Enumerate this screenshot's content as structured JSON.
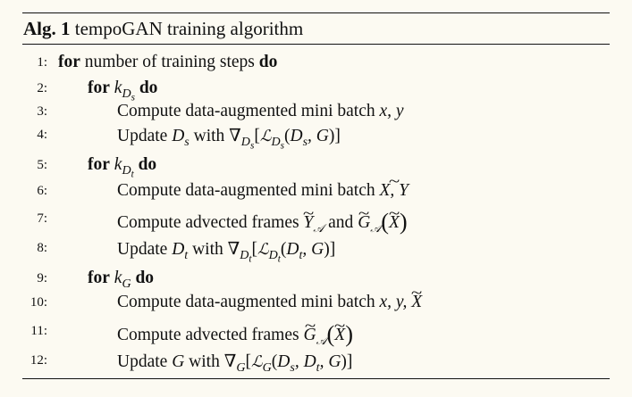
{
  "algorithm": {
    "number_label": "Alg. 1",
    "title": "tempoGAN training algorithm"
  },
  "lines": [
    {
      "num": "1:",
      "kw_for": "for",
      "text": "number of training steps",
      "kw_do": "do"
    },
    {
      "num": "2:",
      "kw_for": "for",
      "var": "k",
      "sub": "D",
      "subsub": "s",
      "kw_do": "do"
    },
    {
      "num": "3:",
      "text": "Compute data-augmented mini batch",
      "vars": "x, y"
    },
    {
      "num": "4:",
      "text_update": "Update",
      "target": "D",
      "target_sub": "s",
      "with": "with",
      "grad": "∇",
      "loss": "ℒ",
      "args": "D",
      "args_sub": "s",
      "args_rest": ", G"
    },
    {
      "num": "5:",
      "kw_for": "for",
      "var": "k",
      "sub": "D",
      "subsub": "t",
      "kw_do": "do"
    },
    {
      "num": "6:",
      "text": "Compute data-augmented mini batch",
      "vars": "X, Y"
    },
    {
      "num": "7:",
      "text": "Compute advected frames",
      "y_sym": "Y",
      "cal_sub": "𝒜",
      "and": "and",
      "g_sym": "G",
      "arg": "X"
    },
    {
      "num": "8:",
      "text_update": "Update",
      "target": "D",
      "target_sub": "t",
      "with": "with",
      "grad": "∇",
      "loss": "ℒ",
      "args": "D",
      "args_sub": "t",
      "args_rest": ", G"
    },
    {
      "num": "9:",
      "kw_for": "for",
      "var": "k",
      "sub": "G",
      "kw_do": "do"
    },
    {
      "num": "10:",
      "text": "Compute data-augmented mini batch",
      "vars": "x, y,",
      "var_extra": "X"
    },
    {
      "num": "11:",
      "text": "Compute advected frames",
      "g_sym": "G",
      "cal_sub": "𝒜",
      "arg": "X"
    },
    {
      "num": "12:",
      "text_update": "Update",
      "target": "G",
      "with": "with",
      "grad": "∇",
      "loss": "ℒ",
      "args": "D",
      "args_sub": "s",
      "args_mid": ", D",
      "args_sub2": "t",
      "args_rest": ", G"
    }
  ]
}
